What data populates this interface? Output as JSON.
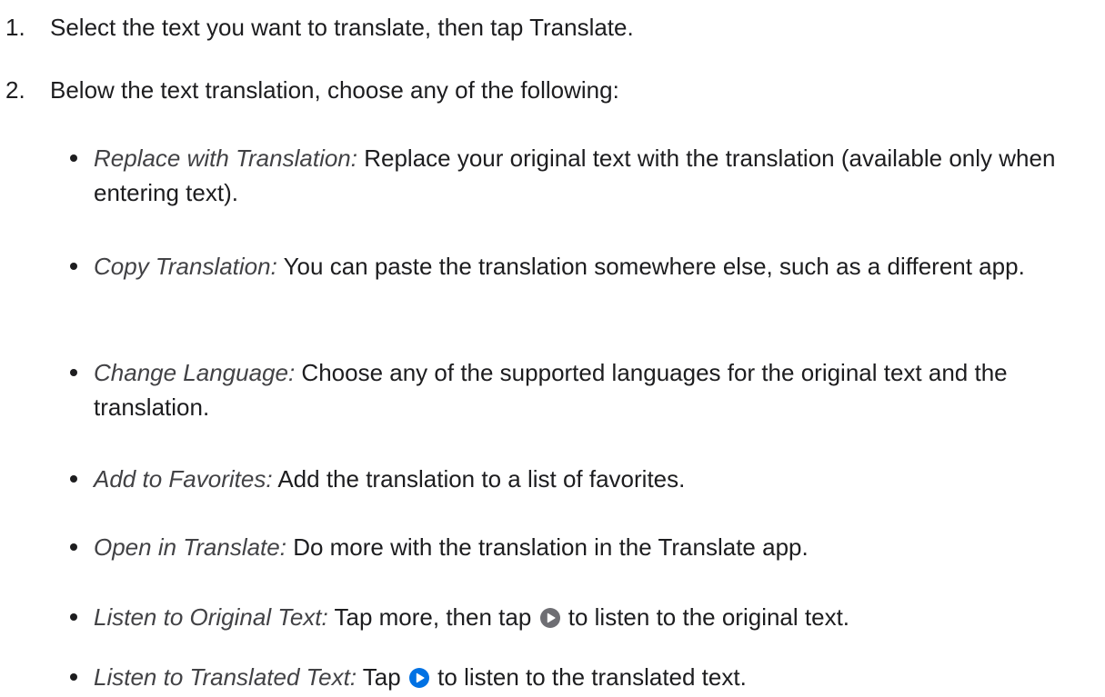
{
  "steps": [
    {
      "number": "1.",
      "text": "Select the text you want to translate, then tap Translate."
    },
    {
      "number": "2.",
      "text": "Below the text translation, choose any of the following:"
    }
  ],
  "options": [
    {
      "term": "Replace with Translation:",
      "text": " Replace your original text with the translation (available only when entering text)."
    },
    {
      "term": "Copy Translation:",
      "text": " You can paste the translation somewhere else, such as a different app."
    },
    {
      "term": "Change Language:",
      "text": " Choose any of the supported languages for the original text and the translation."
    },
    {
      "term": "Add to Favorites:",
      "text": " Add the translation to a list of favorites."
    },
    {
      "term": "Open in Translate:",
      "text": " Do more with the translation in the Translate app."
    },
    {
      "term": "Listen to Original Text:",
      "text_before": " Tap more, then tap ",
      "icon": "play-circle-gray-icon",
      "text_after": " to listen to the original text."
    },
    {
      "term": "Listen to Translated Text:",
      "text_before": " Tap ",
      "icon": "play-circle-blue-icon",
      "text_after": " to listen to the translated text."
    }
  ],
  "colors": {
    "text": "#1d1d1f",
    "term": "#424245",
    "play_gray": "#6e6e73",
    "play_blue": "#0071e3"
  }
}
